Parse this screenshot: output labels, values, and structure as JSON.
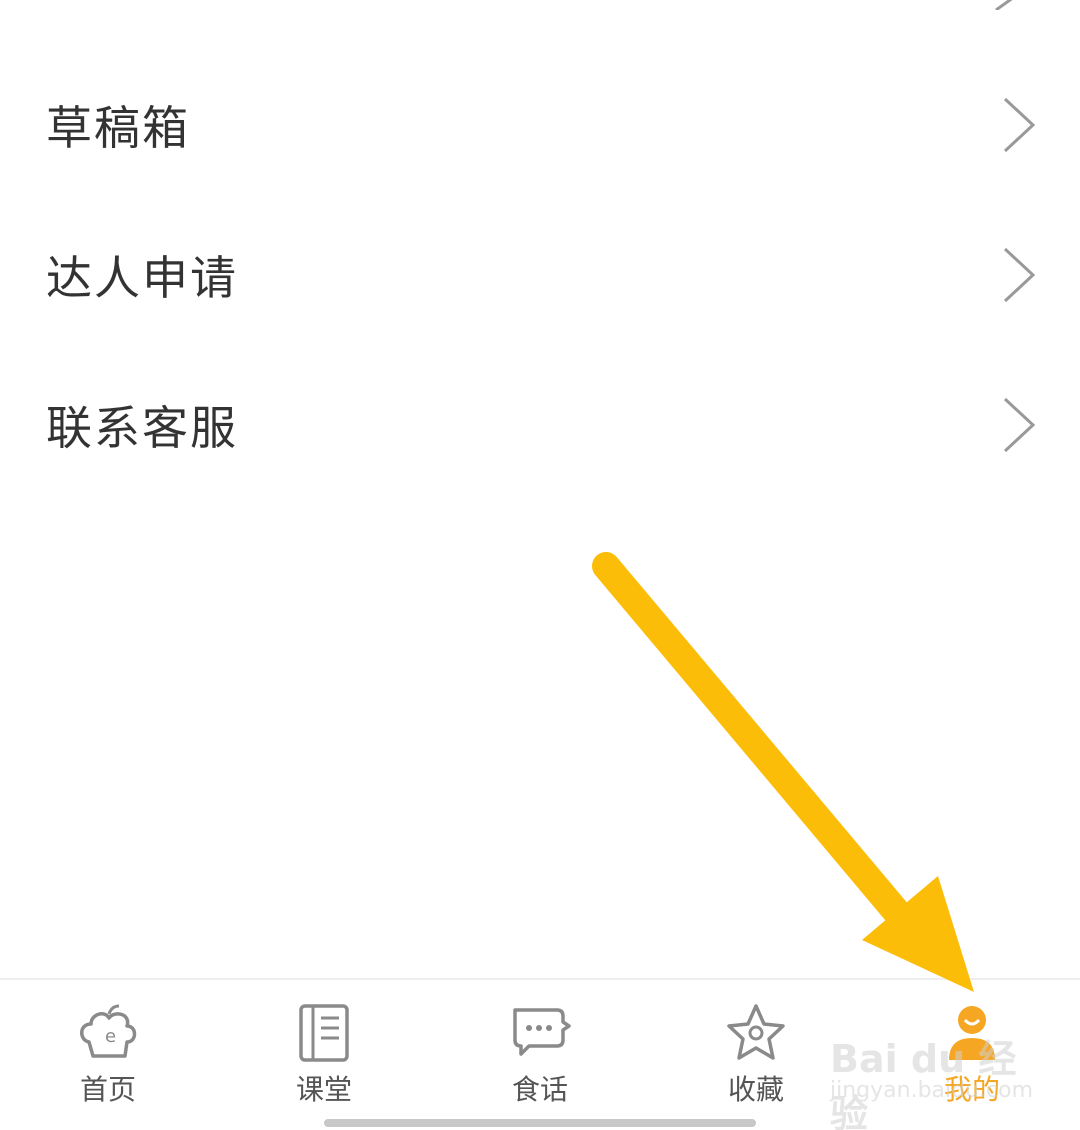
{
  "menu": {
    "items": [
      {
        "label": "草稿箱"
      },
      {
        "label": "达人申请"
      },
      {
        "label": "联系客服"
      }
    ]
  },
  "tabbar": {
    "items": [
      {
        "label": "首页",
        "icon": "chef-hat-icon"
      },
      {
        "label": "课堂",
        "icon": "notebook-icon"
      },
      {
        "label": "食话",
        "icon": "chat-bubble-icon"
      },
      {
        "label": "收藏",
        "icon": "star-icon"
      },
      {
        "label": "我的",
        "icon": "user-icon",
        "active": true
      }
    ]
  },
  "watermark": {
    "line1": "Bai du 经验",
    "line2": "jingyan.baidu.com"
  },
  "colors": {
    "accent": "#f5a623",
    "annotation_arrow": "#fbbd08",
    "text": "#333333",
    "tab_text": "#555555",
    "chevron": "#999999"
  }
}
